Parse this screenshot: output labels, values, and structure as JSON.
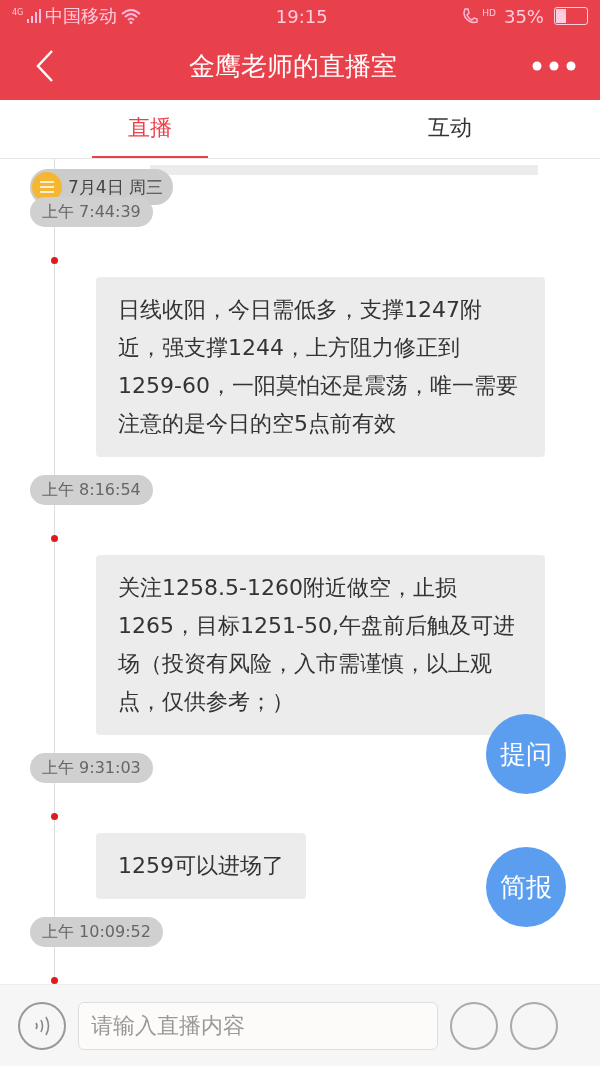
{
  "status_bar": {
    "carrier": "中国移动",
    "time": "19:15",
    "battery": "35%",
    "network": "4G",
    "call": "HD"
  },
  "header": {
    "title": "金鹰老师的直播室"
  },
  "tabs": [
    {
      "label": "直播",
      "selected": true
    },
    {
      "label": "互动",
      "selected": false
    }
  ],
  "date": "7月4日  周三",
  "messages": [
    {
      "time": "上午 7:44:39",
      "text": "日线收阳，今日需低多，支撑1247附近，强支撑1244，上方阻力修正到1259-60，一阳莫怕还是震荡，唯一需要注意的是今日的空5点前有效"
    },
    {
      "time": "上午 8:16:54",
      "text": "关注1258.5-1260附近做空，止损1265，目标1251-50,午盘前后触及可进场（投资有风险，入市需谨慎，以上观点，仅供参考；）"
    },
    {
      "time": "上午 9:31:03",
      "text": "1259可以进场了"
    },
    {
      "time": "上午 10:09:52"
    }
  ],
  "float_buttons": [
    "提问",
    "简报"
  ],
  "input": {
    "placeholder": "请输入直播内容"
  }
}
